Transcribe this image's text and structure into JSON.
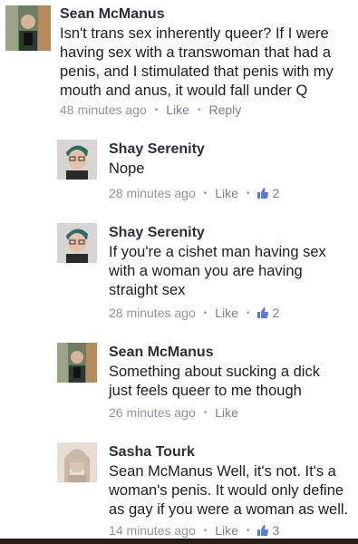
{
  "comments": [
    {
      "author": "Sean McManus",
      "text": "Isn't trans sex inherently queer? If I were having sex with a transwoman that had a penis, and I stimulated that penis with my mouth and anus, it would fall under Q",
      "time": "48 minutes ago",
      "like_label": "Like",
      "reply_label": "Reply"
    },
    {
      "author": "Shay Serenity",
      "text": "Nope",
      "time": "28 minutes ago",
      "like_label": "Like",
      "likes": "2"
    },
    {
      "author": "Shay Serenity",
      "text": "If you're a cishet man having sex with a woman you are having straight sex",
      "time": "28 minutes ago",
      "like_label": "Like",
      "likes": "2"
    },
    {
      "author": "Sean McManus",
      "text": "Something about sucking a dick just feels queer to me though",
      "time": "26 minutes ago",
      "like_label": "Like"
    },
    {
      "author": "Sasha Tourk",
      "text": "Sean McManus Well, it's not. It's a woman's penis. It would only define as gay if you were a woman as well.",
      "time": "14 minutes ago",
      "like_label": "Like",
      "likes": "3"
    }
  ],
  "colors": {
    "like_icon": "#5b7bd5",
    "meta_text": "#90949c",
    "name_text": "#2b2f3a"
  }
}
